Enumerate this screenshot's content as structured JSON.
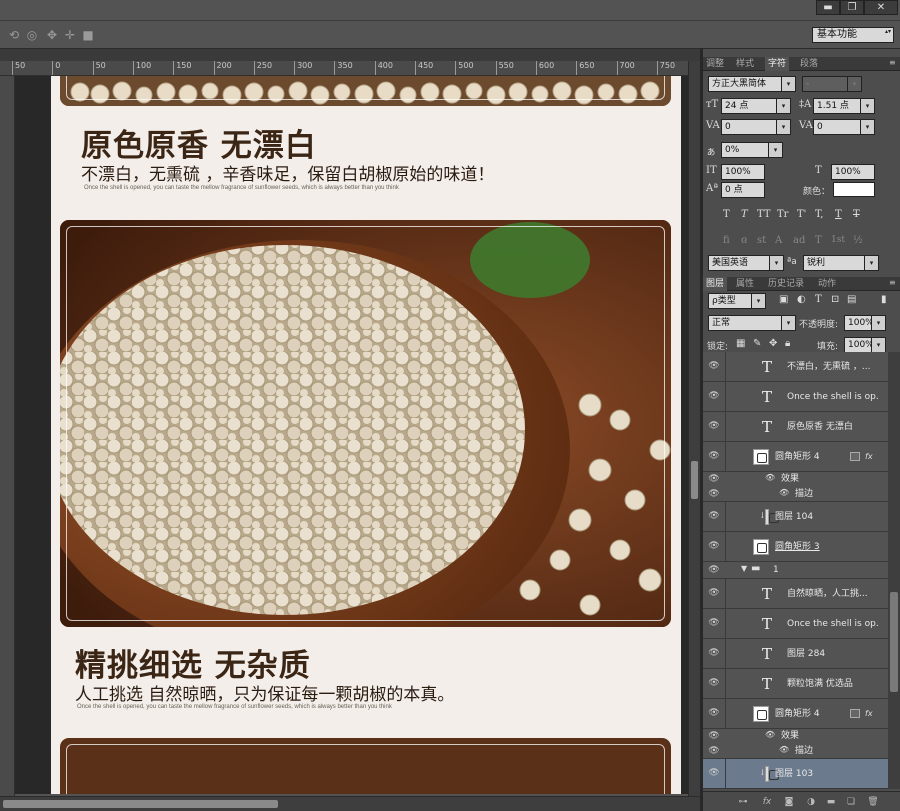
{
  "window": {
    "minimize": "▬",
    "restore": "❐",
    "close": "✕"
  },
  "options_bar": {
    "workspace": "基本功能"
  },
  "ruler": {
    "ticks": [
      "50",
      "0",
      "50",
      "100",
      "150",
      "200",
      "250",
      "300",
      "350",
      "400",
      "450",
      "500",
      "550",
      "600",
      "650",
      "700",
      "750"
    ]
  },
  "document": {
    "section1": {
      "title": "原色原香  无漂白",
      "subtitle": "不漂白，无熏硫 ，辛香味足，保留白胡椒原始的味道！",
      "caption": "Once the shell is opened, you can taste the mellow fragrance of sunflower seeds, which is always better than you think"
    },
    "section2": {
      "title": "精挑细选  无杂质",
      "subtitle": "人工挑选 自然晾晒，只为保证每一颗胡椒的本真。",
      "caption": "Once the shell is opened, you can taste the mellow fragrance of sunflower seeds, which is always better than you think"
    }
  },
  "panel_top": {
    "tabs": [
      "调整",
      "样式",
      "字符",
      "段落"
    ],
    "active_tab": "字符",
    "font_family": "方正大黑简体",
    "font_style": "-",
    "font_size": "24 点",
    "leading": "1.51 点",
    "kerning": "0",
    "tracking": "0",
    "baseline_scale": "0%",
    "vertical_scale": "100%",
    "horizontal_scale": "100%",
    "baseline_shift": "0 点",
    "color_label": "颜色：",
    "color": "#ffffff",
    "style_glyphs": [
      "T",
      "T",
      "TT",
      "Tr",
      "T'",
      "T,",
      "T",
      "T"
    ],
    "opentype_glyphs": [
      "fi",
      "ɞ",
      "st",
      "A",
      "ad",
      "T",
      "1st",
      "½"
    ],
    "language": "美国英语",
    "aa_icon": "ªa",
    "antialias": "锐利"
  },
  "layers_panel": {
    "tabs": [
      "图层",
      "属性",
      "历史记录",
      "动作"
    ],
    "active_tab": "图层",
    "filter_kind": "ρ类型",
    "blend_mode": "正常",
    "opacity_label": "不透明度:",
    "opacity": "100%",
    "lock_label": "锁定:",
    "fill_label": "填充:",
    "fill": "100%",
    "layers": [
      {
        "type": "text",
        "name": "不漂白，无熏硫 ，..."
      },
      {
        "type": "text",
        "name": "Once the shell is op..."
      },
      {
        "type": "text",
        "name": "原色原香  无漂白"
      },
      {
        "type": "shape",
        "name": "圆角矩形 4",
        "fx": "fx"
      },
      {
        "type": "effect",
        "name": "效果"
      },
      {
        "type": "effect-item",
        "name": "描边"
      },
      {
        "type": "clip",
        "name": "图层 104"
      },
      {
        "type": "shape",
        "name": "圆角矩形 3"
      },
      {
        "type": "group",
        "name": "1"
      },
      {
        "type": "text",
        "name": "自然晾晒，人工挑..."
      },
      {
        "type": "text",
        "name": "Once the shell is op..."
      },
      {
        "type": "text",
        "name": "图层 284"
      },
      {
        "type": "text",
        "name": "颗粒饱满 优选品"
      },
      {
        "type": "shape",
        "name": "圆角矩形 4",
        "fx": "fx"
      },
      {
        "type": "effect",
        "name": "效果"
      },
      {
        "type": "effect-item",
        "name": "描边"
      },
      {
        "type": "clip",
        "name": "图层 103",
        "selected": true
      }
    ]
  },
  "colors": {
    "app_bg": "#535353",
    "doc_bg": "#f3eee9",
    "frame": "#5a3019",
    "selected_layer": "#6b7a8c"
  }
}
